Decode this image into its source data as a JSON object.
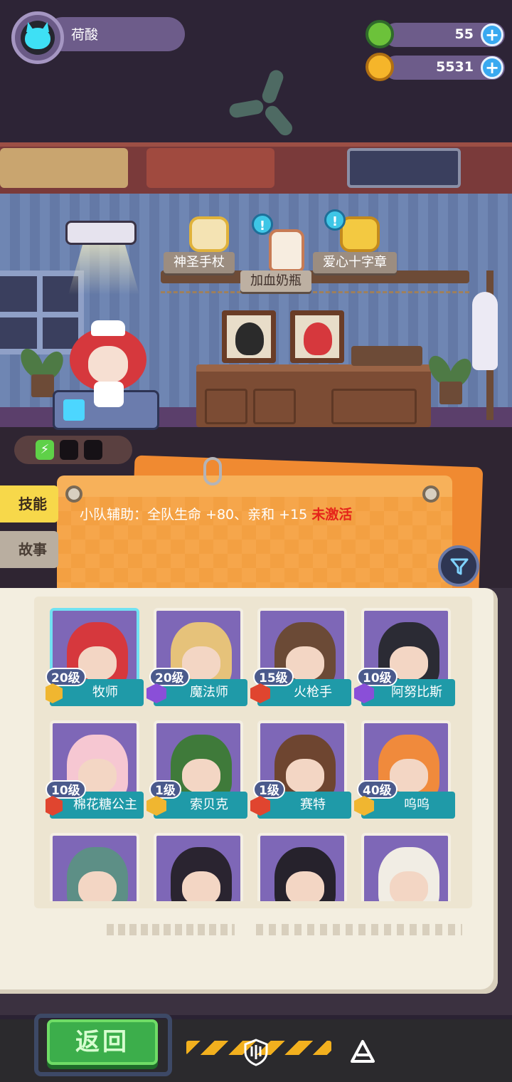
{
  "player": {
    "name": "荷酸"
  },
  "currencies": [
    {
      "icon": "green-donut-coin-icon",
      "value": "55",
      "plus": "+"
    },
    {
      "icon": "gold-planet-coin-icon",
      "value": "5531",
      "plus": "+"
    }
  ],
  "room": {
    "items": [
      {
        "label": "神圣手杖",
        "icon": "holy-staff-icon"
      },
      {
        "label": "加血奶瓶",
        "icon": "healing-bottle-icon"
      },
      {
        "label": "爱心十字章",
        "icon": "heart-cross-badge-icon"
      }
    ],
    "info_bubble": "!"
  },
  "tabs": {
    "skill": "技能",
    "story": "故事"
  },
  "skill": {
    "description": "小队辅助：全队生命 +80、亲和 +15",
    "status": "未激活"
  },
  "heroes": [
    {
      "level": "20级",
      "name": "牧师",
      "badge": "gold",
      "color": "#d6383d",
      "selected": true
    },
    {
      "level": "20级",
      "name": "魔法师",
      "badge": "purple",
      "color": "#e6c27a"
    },
    {
      "level": "15级",
      "name": "火枪手",
      "badge": "red",
      "color": "#6b4a36"
    },
    {
      "level": "10级",
      "name": "阿努比斯",
      "badge": "purple",
      "color": "#2b2b34"
    },
    {
      "level": "10级",
      "name": "棉花糖公主",
      "badge": "red",
      "color": "#f6c7d2"
    },
    {
      "level": "1级",
      "name": "索贝克",
      "badge": "gold",
      "color": "#3f7a3a"
    },
    {
      "level": "1级",
      "name": "赛特",
      "badge": "red",
      "color": "#6e4530"
    },
    {
      "level": "40级",
      "name": "呜呜",
      "badge": "gold",
      "color": "#f08a3c"
    },
    {
      "level": "",
      "name": "",
      "badge": "",
      "color": "#5d8f86"
    },
    {
      "level": "",
      "name": "",
      "badge": "",
      "color": "#2a2430"
    },
    {
      "level": "",
      "name": "",
      "badge": "",
      "color": "#26222c"
    },
    {
      "level": "",
      "name": "",
      "badge": "",
      "color": "#f1ede4"
    }
  ],
  "bottom": {
    "back": "返回"
  },
  "colors": {
    "accent_teal": "#1f9aa8",
    "status_red": "#e5231a",
    "tab_active": "#f7d84a",
    "back_green": "#3cae4b"
  }
}
